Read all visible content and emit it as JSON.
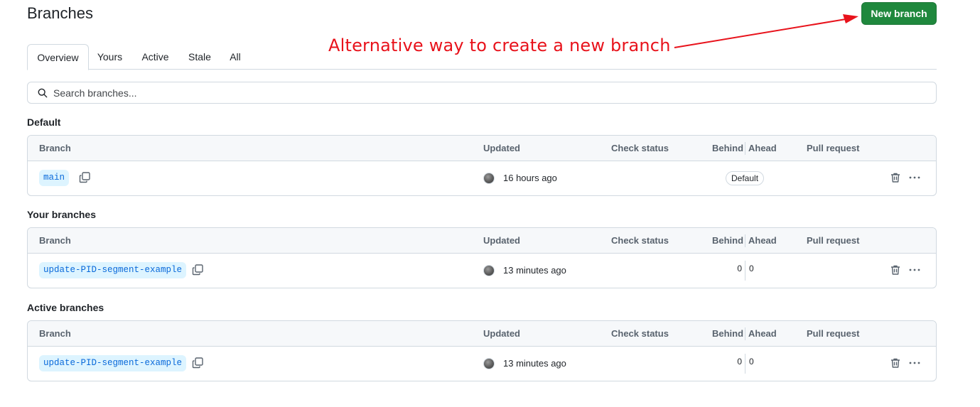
{
  "page": {
    "title": "Branches"
  },
  "header": {
    "new_branch_label": "New branch"
  },
  "annotation": {
    "text": "Alternative way to create a new branch",
    "color": "#e8121b"
  },
  "tabs": [
    {
      "label": "Overview",
      "selected": true
    },
    {
      "label": "Yours",
      "selected": false
    },
    {
      "label": "Active",
      "selected": false
    },
    {
      "label": "Stale",
      "selected": false
    },
    {
      "label": "All",
      "selected": false
    }
  ],
  "search": {
    "placeholder": "Search branches...",
    "icon": "search-icon"
  },
  "table_headers": {
    "branch": "Branch",
    "updated": "Updated",
    "check_status": "Check status",
    "behind": "Behind",
    "ahead": "Ahead",
    "pull_request": "Pull request"
  },
  "sections": [
    {
      "heading": "Default",
      "rows": [
        {
          "branch": "main",
          "updated": "16 hours ago",
          "badge": "Default"
        }
      ]
    },
    {
      "heading": "Your branches",
      "rows": [
        {
          "branch": "update-PID-segment-example",
          "updated": "13 minutes ago",
          "behind": "0",
          "ahead": "0"
        }
      ]
    },
    {
      "heading": "Active branches",
      "rows": [
        {
          "branch": "update-PID-segment-example",
          "updated": "13 minutes ago",
          "behind": "0",
          "ahead": "0"
        }
      ]
    }
  ],
  "colors": {
    "primary_button": "#1f883d",
    "branch_chip_bg": "#ddf4ff",
    "branch_chip_text": "#0969da",
    "border": "#d1d9e0",
    "header_bg": "#f6f8fa"
  }
}
